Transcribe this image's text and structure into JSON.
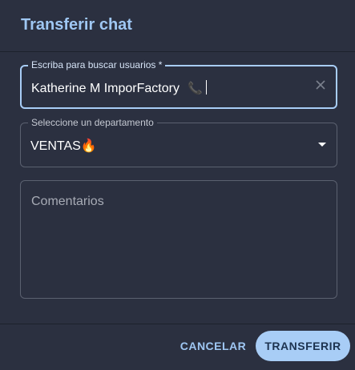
{
  "dialog": {
    "title": "Transferir chat"
  },
  "user_search": {
    "label": "Escriba para buscar usuarios *",
    "value": "Katherine M ImporFactory",
    "status_icon": "phone-icon",
    "clear_icon": "close-icon"
  },
  "department": {
    "label": "Seleccione un departamento",
    "selected": "VENTAS🔥",
    "dropdown_icon": "caret-down-icon"
  },
  "comments": {
    "placeholder": "Comentarios"
  },
  "actions": {
    "cancel_label": "CANCELAR",
    "transfer_label": "TRANSFERIR"
  },
  "colors": {
    "accent": "#a8cdf6",
    "title": "#9fc7f3",
    "background": "#2b3040",
    "phone_icon": "#e5484d"
  }
}
